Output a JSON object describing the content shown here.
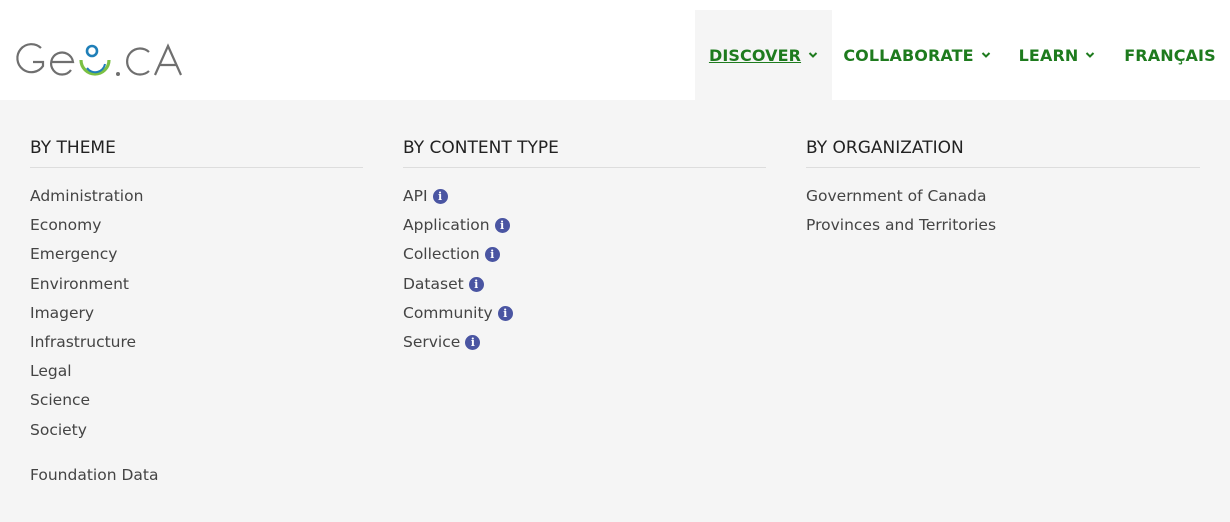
{
  "brand": {
    "logo_text": "GEO.CA"
  },
  "nav": {
    "items": [
      {
        "label": "DISCOVER",
        "has_dropdown": true,
        "active": true
      },
      {
        "label": "COLLABORATE",
        "has_dropdown": true,
        "active": false
      },
      {
        "label": "LEARN",
        "has_dropdown": true,
        "active": false
      },
      {
        "label": "FRANÇAIS",
        "has_dropdown": false,
        "active": false
      }
    ]
  },
  "menu": {
    "by_theme": {
      "heading": "BY THEME",
      "items": [
        "Administration",
        "Economy",
        "Emergency",
        "Environment",
        "Imagery",
        "Infrastructure",
        "Legal",
        "Science",
        "Society"
      ],
      "extra": "Foundation Data"
    },
    "by_content_type": {
      "heading": "BY CONTENT TYPE",
      "items": [
        "API",
        "Application",
        "Collection",
        "Dataset",
        "Community",
        "Service"
      ],
      "info_icon": "i"
    },
    "by_organization": {
      "heading": "BY ORGANIZATION",
      "items": [
        "Government of Canada",
        "Provinces and Territories"
      ]
    }
  },
  "colors": {
    "nav_green": "#1e7b1e",
    "info_blue": "#4a55a2",
    "panel_bg": "#f5f5f5",
    "logo_gray": "#6f6f6f",
    "logo_blue": "#1f7fb8",
    "logo_green": "#7bc043"
  }
}
